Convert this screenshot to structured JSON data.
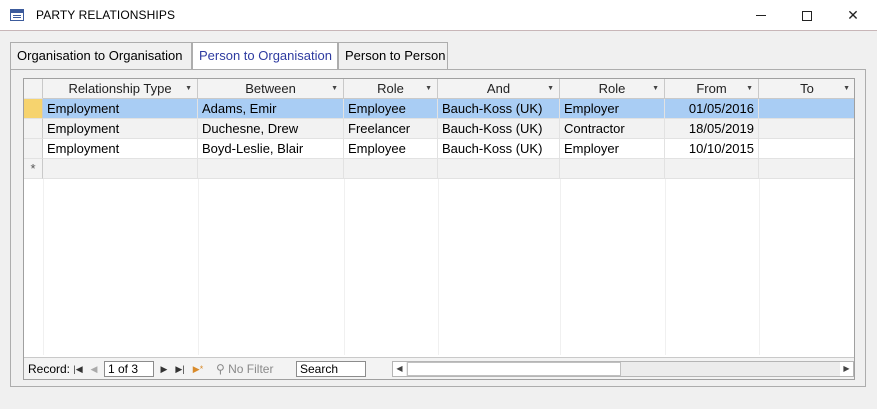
{
  "window": {
    "title": "PARTY RELATIONSHIPS",
    "minimize_glyph": "—",
    "maximize_glyph": "☐",
    "close_glyph": "✕"
  },
  "tabs": [
    {
      "label": "Organisation to Organisation",
      "active": false
    },
    {
      "label": "Person to Organisation",
      "active": true
    },
    {
      "label": "Person to Person",
      "active": false
    }
  ],
  "grid": {
    "columns": [
      "Relationship Type",
      "Between",
      "Role",
      "And",
      "Role",
      "From",
      "To"
    ],
    "rows": [
      {
        "type": "Employment",
        "between": "Adams, Emir",
        "role1": "Employee",
        "and": "Bauch-Koss (UK)",
        "role2": "Employer",
        "from": "01/05/2016",
        "to": ""
      },
      {
        "type": "Employment",
        "between": "Duchesne, Drew",
        "role1": "Freelancer",
        "and": "Bauch-Koss (UK)",
        "role2": "Contractor",
        "from": "18/05/2019",
        "to": ""
      },
      {
        "type": "Employment",
        "between": "Boyd-Leslie, Blair",
        "role1": "Employee",
        "and": "Bauch-Koss (UK)",
        "role2": "Employer",
        "from": "10/10/2015",
        "to": ""
      }
    ],
    "new_record_glyph": "*"
  },
  "navigation": {
    "record_label": "Record:",
    "record_value": "1 of 3",
    "filter_label": "No Filter",
    "search_label": "Search"
  },
  "colors": {
    "selected_row": "#a9cdf4",
    "active_selector": "#f6d36e",
    "active_tab_text": "#2e3ba0"
  }
}
